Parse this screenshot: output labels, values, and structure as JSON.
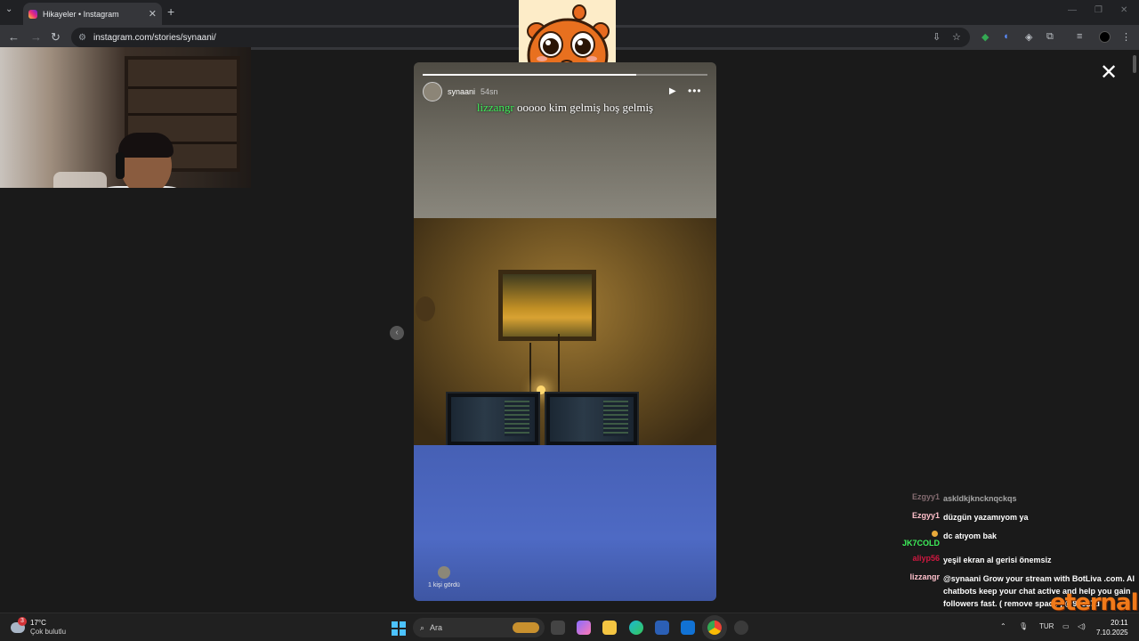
{
  "browser": {
    "tab_title": "Hikayeler • Instagram",
    "url": "instagram.com/stories/synaani/",
    "new_tab": "+"
  },
  "story": {
    "username": "synaani",
    "time_ago": "54sn",
    "progress": 0.75,
    "viewers_text": "1 kişi gördü",
    "caption": {
      "name": "lizzangr",
      "text": "ooooo kim gelmiş hoş gelmiş"
    }
  },
  "chat": [
    {
      "user": "Ezgyy1",
      "color": "#c8a0a8",
      "message": "askldkjkncknqckqs",
      "faded": true
    },
    {
      "user": "Ezgyy1",
      "color": "#ffc0cb",
      "message": "düzgün yazamıyom ya"
    },
    {
      "user": "JK7COLD",
      "color": "#3df05a",
      "message": "dc atıyom bak",
      "badge": true
    },
    {
      "user": "aliyp56",
      "color": "#d01840",
      "message": "yeşil ekran al gerisi önemsiz"
    },
    {
      "user": "lizzangr",
      "color": "#ffc0cb",
      "message": "@synaani Grow your stream with BotLiva .com. AI chatbots keep your chat active and help you gain followers fast. ( remove space ) @9ee27d"
    }
  ],
  "brand": "eternal",
  "taskbar": {
    "weather_temp": "17°C",
    "weather_desc": "Çok bulutlu",
    "weather_badge": "3",
    "search_placeholder": "Ara",
    "language": "TUR",
    "time": "20:11",
    "date": "7.10.2025"
  }
}
